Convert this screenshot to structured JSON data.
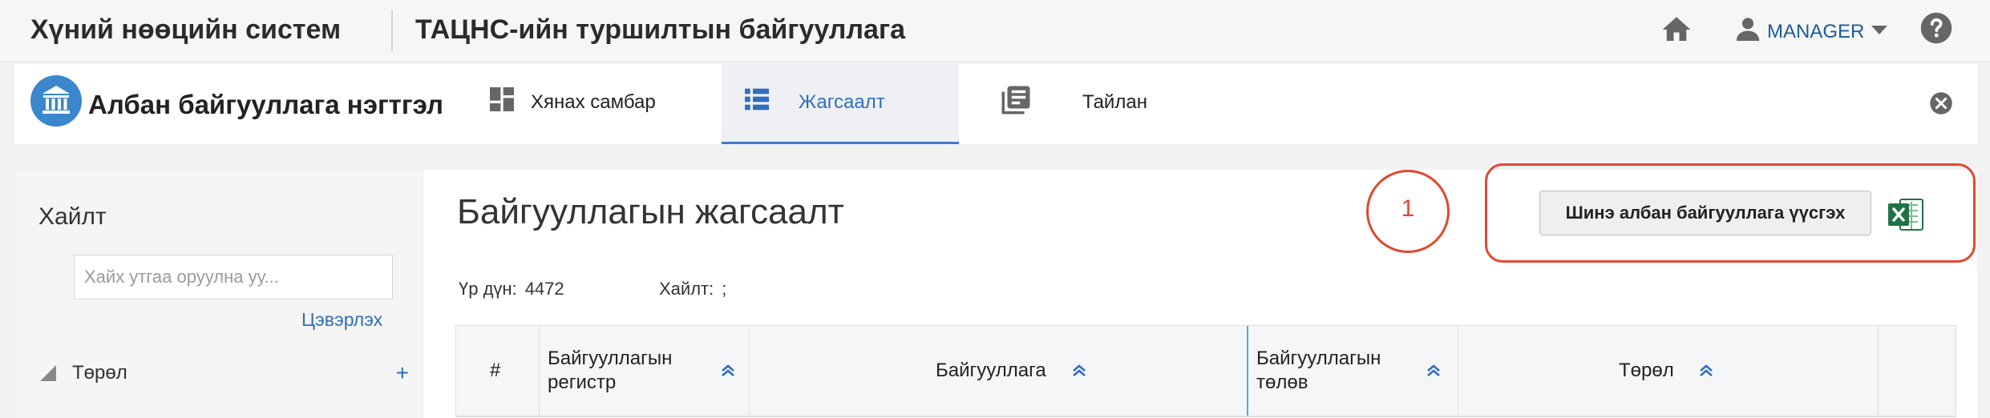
{
  "topbar": {
    "system_title": "Хүний нөөцийн систем",
    "org_title": "ТАЦНС-ийн туршилтын байгууллага",
    "user_name": "MANAGER",
    "icons": {
      "home": "home-icon",
      "user": "user-icon",
      "caret": "caret-down-icon",
      "help": "help-icon"
    }
  },
  "module": {
    "title": "Албан байгууллага нэгтгэл",
    "tabs": [
      {
        "label": "Хянах самбар",
        "icon": "dashboard-icon",
        "active": false
      },
      {
        "label": "Жагсаалт",
        "icon": "list-icon",
        "active": true
      },
      {
        "label": "Тайлан",
        "icon": "report-icon",
        "active": false
      }
    ],
    "accent_color": "#3b7bcd"
  },
  "sidebar": {
    "search_title": "Хайлт",
    "search_placeholder": "Хайх утгаа оруулна уу...",
    "clear_label": "Цэвэрлэх",
    "type_label": "Төрөл",
    "type_add": "+"
  },
  "main": {
    "page_title": "Байгууллагын жагсаалт",
    "annotation_number": "1",
    "new_button_label": "Шинэ албан байгууллага үүсгэх",
    "stats": {
      "total_label": "Үр дүн:",
      "total_value": "4472",
      "search_label": "Хайлт:",
      "search_value": ";"
    },
    "table": {
      "columns": [
        {
          "label": "#",
          "sortable": false
        },
        {
          "label": "Байгууллагын регистр",
          "sortable": true
        },
        {
          "label": "Байгууллага",
          "sortable": true
        },
        {
          "label": "Байгууллагын төлөв",
          "sortable": true
        },
        {
          "label": "Төрөл",
          "sortable": true
        },
        {
          "label": "",
          "sortable": false
        }
      ]
    }
  },
  "colors": {
    "annotation": "#e0482f",
    "link": "#2f6fbf",
    "excel_green": "#1f7244"
  }
}
